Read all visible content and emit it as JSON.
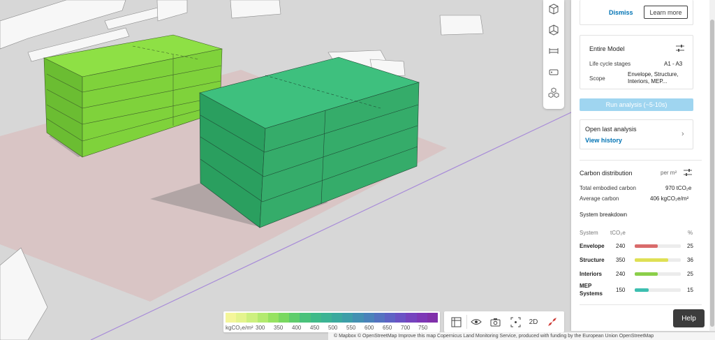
{
  "panel": {
    "notice": {
      "dismiss_label": "Dismiss",
      "learn_more_label": "Learn more"
    },
    "model": {
      "title": "Entire Model",
      "lifecycle_label": "Life cycle stages",
      "lifecycle_value": "A1 - A3",
      "scope_label": "Scope",
      "scope_value_line1": "Envelope, Structure,",
      "scope_value_line2": "Interiors, MEP..."
    },
    "run_button_label": "Run analysis (~5-10s)",
    "last_analysis": {
      "title": "Open last analysis",
      "link": "View history"
    },
    "carbon": {
      "title": "Carbon distribution",
      "unit_selector": "per m²",
      "total_label": "Total embodied carbon",
      "total_value": "970 tCO₂e",
      "avg_label": "Average carbon",
      "avg_value": "406 kgCO₂e/m²",
      "breakdown_title": "System breakdown",
      "col_system": "System",
      "col_tco2e": "tCO₂e",
      "col_pct": "%",
      "systems": [
        {
          "name": "Envelope",
          "value": "240",
          "pct": "25",
          "fraction": 0.25,
          "color": "#d96b6b"
        },
        {
          "name": "Structure",
          "value": "350",
          "pct": "36",
          "fraction": 0.36,
          "color": "#dfe055"
        },
        {
          "name": "Interiors",
          "value": "240",
          "pct": "25",
          "fraction": 0.25,
          "color": "#8bcf4a"
        },
        {
          "name": "MEP",
          "name2": "Systems",
          "value": "150",
          "pct": "15",
          "fraction": 0.15,
          "color": "#3dbfb0"
        }
      ]
    }
  },
  "legend": {
    "unit": "kgCO₂e/m²",
    "ticks": [
      "300",
      "350",
      "400",
      "450",
      "500",
      "550",
      "600",
      "650",
      "700",
      "750"
    ],
    "colors": [
      "#f4f69a",
      "#e4f48e",
      "#cdf07f",
      "#b3ea6f",
      "#96e261",
      "#79d860",
      "#5ecd6c",
      "#4ac27b",
      "#3fba89",
      "#3cb394",
      "#3aa99e",
      "#3d9ea8",
      "#4390b2",
      "#4a82ba",
      "#5472c0",
      "#5e62c4",
      "#6a52c4",
      "#7543be",
      "#7d37b6",
      "#8030aa"
    ]
  },
  "viewbar": {
    "mode_2d": "2D"
  },
  "help_label": "Help",
  "attribution": "© Mapbox © OpenStreetMap  Improve this map  Copernicus Land Monitoring Service, produced with funding by the European Union  OpenStreetMap",
  "icons": {
    "toolbar": [
      "cube-top-icon",
      "cube-side-icon",
      "measure-icon",
      "tag-icon",
      "cubes-icon"
    ],
    "viewbar": [
      "grid-view-icon",
      "eye-icon",
      "camera-icon",
      "focus-icon",
      "compass-icon"
    ]
  }
}
